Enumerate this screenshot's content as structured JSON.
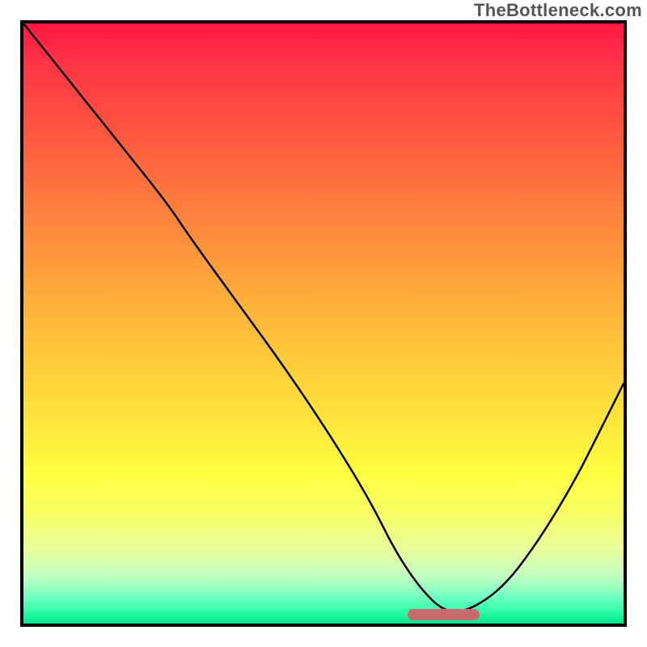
{
  "watermark": "TheBottleneck.com",
  "chart_data": {
    "type": "line",
    "title": "",
    "xlabel": "",
    "ylabel": "",
    "xlim": [
      0,
      100
    ],
    "ylim": [
      0,
      100
    ],
    "grid": false,
    "legend": false,
    "series": [
      {
        "name": "bottleneck-curve",
        "x": [
          0,
          8,
          16,
          24,
          28,
          36,
          44,
          52,
          58,
          62,
          66,
          70,
          74,
          80,
          86,
          92,
          96,
          100
        ],
        "y": [
          100,
          90,
          80,
          70,
          64,
          53,
          42,
          30,
          20,
          12,
          6,
          2,
          2,
          6,
          14,
          24,
          32,
          40
        ]
      }
    ],
    "annotations": [
      {
        "name": "optimal-range-marker",
        "type": "hspan",
        "x0": 64,
        "x1": 76,
        "y": 0.7,
        "color": "#c96a6f"
      }
    ],
    "background": {
      "type": "vertical-gradient",
      "stops": [
        {
          "pos": 0,
          "color": "#ff1744"
        },
        {
          "pos": 0.06,
          "color": "#ff3245"
        },
        {
          "pos": 0.18,
          "color": "#ff5640"
        },
        {
          "pos": 0.3,
          "color": "#ff7c3d"
        },
        {
          "pos": 0.42,
          "color": "#ffa23b"
        },
        {
          "pos": 0.54,
          "color": "#ffc53a"
        },
        {
          "pos": 0.66,
          "color": "#ffe43c"
        },
        {
          "pos": 0.75,
          "color": "#ffff40"
        },
        {
          "pos": 0.81,
          "color": "#faff60"
        },
        {
          "pos": 0.88,
          "color": "#e6ffa0"
        },
        {
          "pos": 0.92,
          "color": "#c2ffc0"
        },
        {
          "pos": 0.95,
          "color": "#80ffc4"
        },
        {
          "pos": 0.975,
          "color": "#3cffb0"
        },
        {
          "pos": 1.0,
          "color": "#00e889"
        }
      ]
    }
  }
}
